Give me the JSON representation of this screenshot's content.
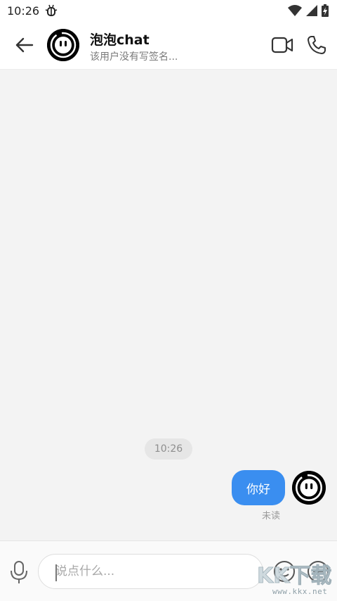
{
  "status_bar": {
    "time": "10:26",
    "icons": [
      "bug-icon",
      "wifi-icon",
      "signal-icon",
      "battery-charging-icon"
    ]
  },
  "header": {
    "title": "泡泡chat",
    "subtitle": "该用户没有写签名...",
    "icons": [
      "back-arrow-icon",
      "avatar",
      "video-call-icon",
      "phone-icon"
    ]
  },
  "chat": {
    "background_color": "#f3f3f3",
    "time_divider": "10:26",
    "messages": [
      {
        "direction": "outgoing",
        "text": "你好",
        "status": "未读",
        "bubble_color": "#3a8ef0"
      }
    ]
  },
  "input_bar": {
    "placeholder": "说点什么...",
    "value": "",
    "icons": [
      "microphone-icon",
      "emoji-icon",
      "plus-icon"
    ]
  },
  "watermark": {
    "text": "www.kkx.net",
    "logo": "KK下载"
  }
}
